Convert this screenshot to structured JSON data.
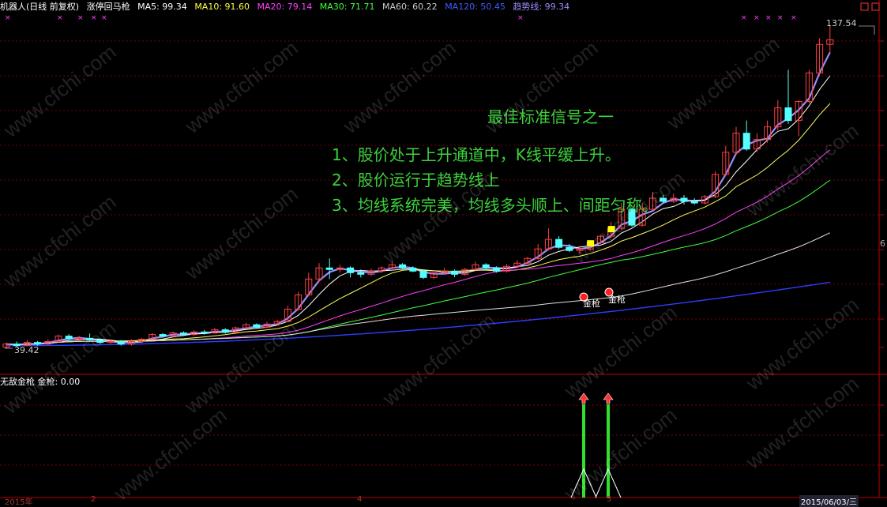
{
  "header": {
    "title": "机器人(日线 前复权)",
    "indicator": "涨停回马枪",
    "ma": [
      {
        "label": "MA5: 99.34",
        "color": "#ffffff"
      },
      {
        "label": "MA10: 91.60",
        "color": "#ffff40"
      },
      {
        "label": "MA20: 79.14",
        "color": "#ff40ff"
      },
      {
        "label": "MA30: 71.71",
        "color": "#40ff40"
      },
      {
        "label": "MA60: 60.22",
        "color": "#cccccc"
      },
      {
        "label": "MA120: 50.45",
        "color": "#3f5cff"
      },
      {
        "label": "趋势线: 99.34",
        "color": "#9a8dff"
      }
    ]
  },
  "price_labels": {
    "high": "137.54",
    "low": "39.42"
  },
  "annotation": {
    "title": "最佳标准信号之一",
    "lines": [
      "1、股价处于上升通道中，K线平缓上升。",
      "2、股价运行于趋势线上",
      "3、均线系统完美，均线多头顺上、间距匀称。"
    ]
  },
  "signals": [
    {
      "label": "金枪"
    },
    {
      "label": "金枪"
    }
  ],
  "sub_panel": {
    "title": "无敌金枪",
    "value_label": "金枪: 0.00"
  },
  "bottom_axis": [
    "2015年",
    "2",
    "4",
    "5",
    "2015/06/03/三"
  ],
  "right_edge_label": "6",
  "watermark": "www.cfchi.com",
  "colors": {
    "up": "#ff4040",
    "down": "#54ffff",
    "grid": "#7a0000",
    "trend": "#9a8dff"
  },
  "chart_data": {
    "type": "candlestick",
    "y_range": [
      39.42,
      137.54
    ],
    "candles": [
      [
        40.5,
        41.5,
        40,
        42
      ],
      [
        41.5,
        41,
        40.5,
        42.3
      ],
      [
        41,
        42,
        40.8,
        42.8
      ],
      [
        42,
        41.5,
        41,
        42.5
      ],
      [
        41.5,
        42.3,
        41.2,
        43
      ],
      [
        42.3,
        44,
        42,
        44.5
      ],
      [
        44,
        43.2,
        42.8,
        44.6
      ],
      [
        43.2,
        43.3,
        42.5,
        44
      ],
      [
        43.3,
        42.8,
        42.5,
        44.8
      ],
      [
        42.8,
        42,
        41.6,
        43
      ],
      [
        42,
        42.3,
        41.5,
        43
      ],
      [
        42.3,
        41.5,
        41,
        42.8
      ],
      [
        41.5,
        42.3,
        41,
        43
      ],
      [
        42.3,
        43,
        42,
        43.4
      ],
      [
        43,
        44.5,
        42.8,
        45
      ],
      [
        44.5,
        44,
        43.5,
        45
      ],
      [
        44,
        45,
        43.6,
        45.4
      ],
      [
        45,
        44.5,
        44,
        45.5
      ],
      [
        44.5,
        45.3,
        44,
        45.8
      ],
      [
        45.3,
        45,
        44.5,
        46
      ],
      [
        45,
        46,
        44.8,
        46.6
      ],
      [
        46,
        45.2,
        44.8,
        46.5
      ],
      [
        45.2,
        46.6,
        45,
        47
      ],
      [
        46.6,
        47.6,
        46.3,
        48.2
      ],
      [
        47.6,
        46.8,
        46.5,
        48
      ],
      [
        46.8,
        47.8,
        46.5,
        48.5
      ],
      [
        47.8,
        48.6,
        47.5,
        49.1
      ],
      [
        48.6,
        52.5,
        48.3,
        53.5
      ],
      [
        52.5,
        57,
        52,
        58
      ],
      [
        57,
        62,
        56.5,
        64
      ],
      [
        62,
        65.5,
        61,
        67
      ],
      [
        65.5,
        65,
        62,
        68.5
      ],
      [
        65,
        65.5,
        64,
        66.5
      ],
      [
        65.5,
        64,
        62.5,
        66
      ],
      [
        64,
        63.5,
        62.5,
        65
      ],
      [
        63.5,
        64.5,
        63,
        65.3
      ],
      [
        64.5,
        65.5,
        64,
        66
      ],
      [
        65.5,
        66.5,
        65,
        67.5
      ],
      [
        66.5,
        65.5,
        65,
        67
      ],
      [
        65.5,
        64.5,
        64.2,
        66
      ],
      [
        64.5,
        62.5,
        62,
        65
      ],
      [
        62.5,
        64,
        62,
        64.8
      ],
      [
        64,
        64.5,
        63.5,
        65.5
      ],
      [
        64.5,
        63.5,
        62.6,
        65
      ],
      [
        63.5,
        65,
        63,
        65.5
      ],
      [
        65,
        66.5,
        64.5,
        67.5
      ],
      [
        66.5,
        65.5,
        65,
        67
      ],
      [
        65.5,
        64.5,
        64,
        66
      ],
      [
        64.5,
        66,
        64,
        66.8
      ],
      [
        66,
        67,
        65.5,
        68
      ],
      [
        67,
        68.5,
        66.5,
        69
      ],
      [
        68.5,
        71.5,
        68,
        73
      ],
      [
        71.5,
        74.5,
        71,
        78
      ],
      [
        74.5,
        72,
        71.5,
        75.5
      ],
      [
        72,
        71,
        70.5,
        73
      ],
      [
        71,
        71.5,
        70,
        72.5
      ],
      [
        71.5,
        73.5,
        71,
        74
      ],
      [
        73.5,
        75.5,
        73,
        76
      ],
      [
        75.5,
        78,
        75,
        80
      ],
      [
        78,
        84,
        77.5,
        86
      ],
      [
        84,
        79,
        78.5,
        84.5
      ],
      [
        79,
        84,
        78.5,
        86
      ],
      [
        84,
        87.5,
        83.5,
        89.5
      ],
      [
        87.5,
        86.5,
        86,
        88.5
      ],
      [
        86.5,
        87.5,
        86,
        89
      ],
      [
        87.5,
        86.5,
        85.5,
        88.5
      ],
      [
        86.5,
        86,
        85.5,
        87.5
      ],
      [
        86,
        88,
        85.5,
        88.5
      ],
      [
        88,
        95,
        87.5,
        96
      ],
      [
        95,
        102,
        94.5,
        104
      ],
      [
        102,
        108,
        101,
        110
      ],
      [
        108,
        103,
        102.5,
        112
      ],
      [
        103,
        106,
        102,
        108
      ],
      [
        106,
        110,
        105,
        112
      ],
      [
        110,
        116,
        109,
        118.5
      ],
      [
        116,
        112,
        111,
        128
      ],
      [
        112,
        118,
        107,
        118.5
      ],
      [
        118,
        127,
        117.5,
        128
      ],
      [
        127,
        136,
        126,
        138
      ],
      [
        136,
        137.5,
        133,
        142
      ]
    ]
  }
}
